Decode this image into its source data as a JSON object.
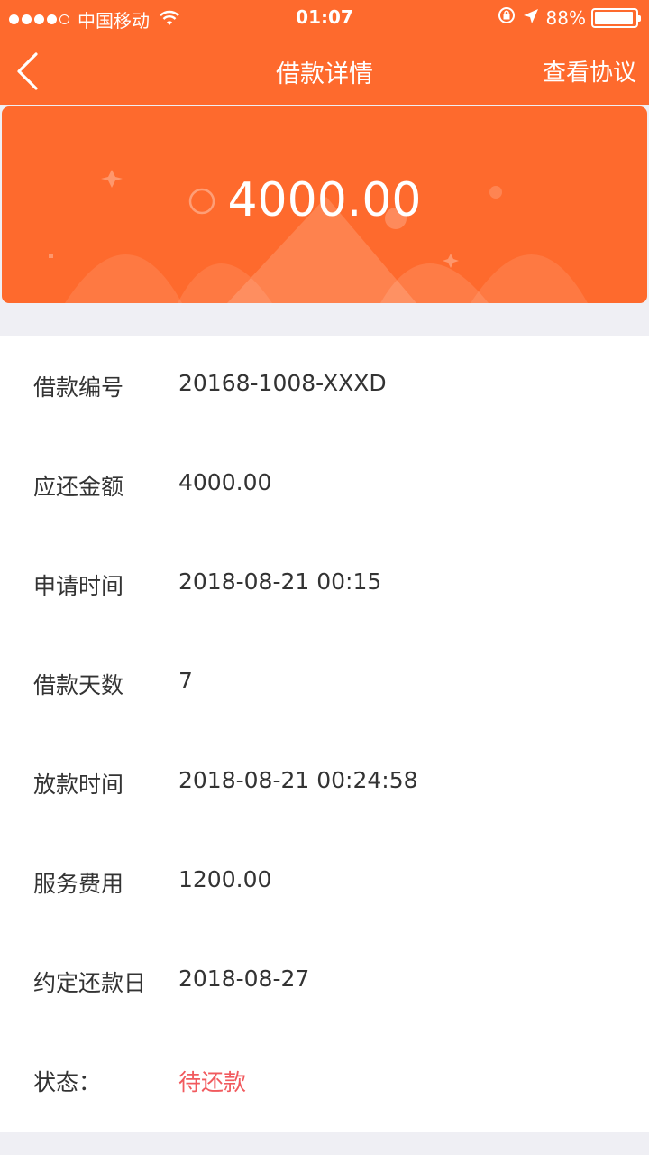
{
  "status_bar": {
    "carrier": "中国移动",
    "time": "01:07",
    "battery": "88%",
    "battery_level": 0.88
  },
  "nav": {
    "title": "借款详情",
    "right_action": "查看协议",
    "back_icon": "chevron-left-icon"
  },
  "banner": {
    "amount": "4000.00"
  },
  "details": [
    {
      "label": "借款编号",
      "value": "20168-1008-XXXD"
    },
    {
      "label": "应还金额",
      "value": "4000.00"
    },
    {
      "label": "申请时间",
      "value": "2018-08-21 00:15"
    },
    {
      "label": "借款天数",
      "value": "7"
    },
    {
      "label": "放款时间",
      "value": "2018-08-21 00:24:58"
    },
    {
      "label": "服务费用",
      "value": "1200.00"
    },
    {
      "label": "约定还款日",
      "value": "2018-08-27"
    },
    {
      "label": "状态：",
      "value": "待还款"
    }
  ],
  "colors": {
    "brand": "#fe6a2d",
    "status_pending": "#f15a5e",
    "background": "#efeff4"
  }
}
